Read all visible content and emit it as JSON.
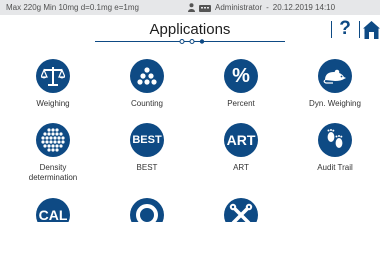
{
  "status": {
    "balance_info": "Max 220g  Min 10mg  d=0.1mg  e=1mg",
    "user": "Administrator",
    "datetime": "20.12.2019 14:10"
  },
  "header": {
    "title": "Applications",
    "help_label": "?"
  },
  "apps": [
    {
      "label": "Weighing",
      "icon": "balance-scale-icon"
    },
    {
      "label": "Counting",
      "icon": "counting-dots-icon"
    },
    {
      "label": "Percent",
      "icon": "percent-icon",
      "glyph": "%"
    },
    {
      "label": "Dyn. Weighing",
      "icon": "mouse-icon"
    },
    {
      "label": "Density\ndetermination",
      "icon": "density-dots-icon"
    },
    {
      "label": "BEST",
      "icon": "best-icon",
      "glyph": "BEST"
    },
    {
      "label": "ART",
      "icon": "art-icon",
      "glyph": "ART"
    },
    {
      "label": "Audit Trail",
      "icon": "footprints-icon"
    },
    {
      "label": "",
      "icon": "cal-icon",
      "glyph": "CAL"
    },
    {
      "label": "",
      "icon": "ring-icon"
    },
    {
      "label": "",
      "icon": "tools-icon"
    }
  ],
  "colors": {
    "accent": "#0e4a84",
    "status_bg": "#e6e7e9"
  }
}
